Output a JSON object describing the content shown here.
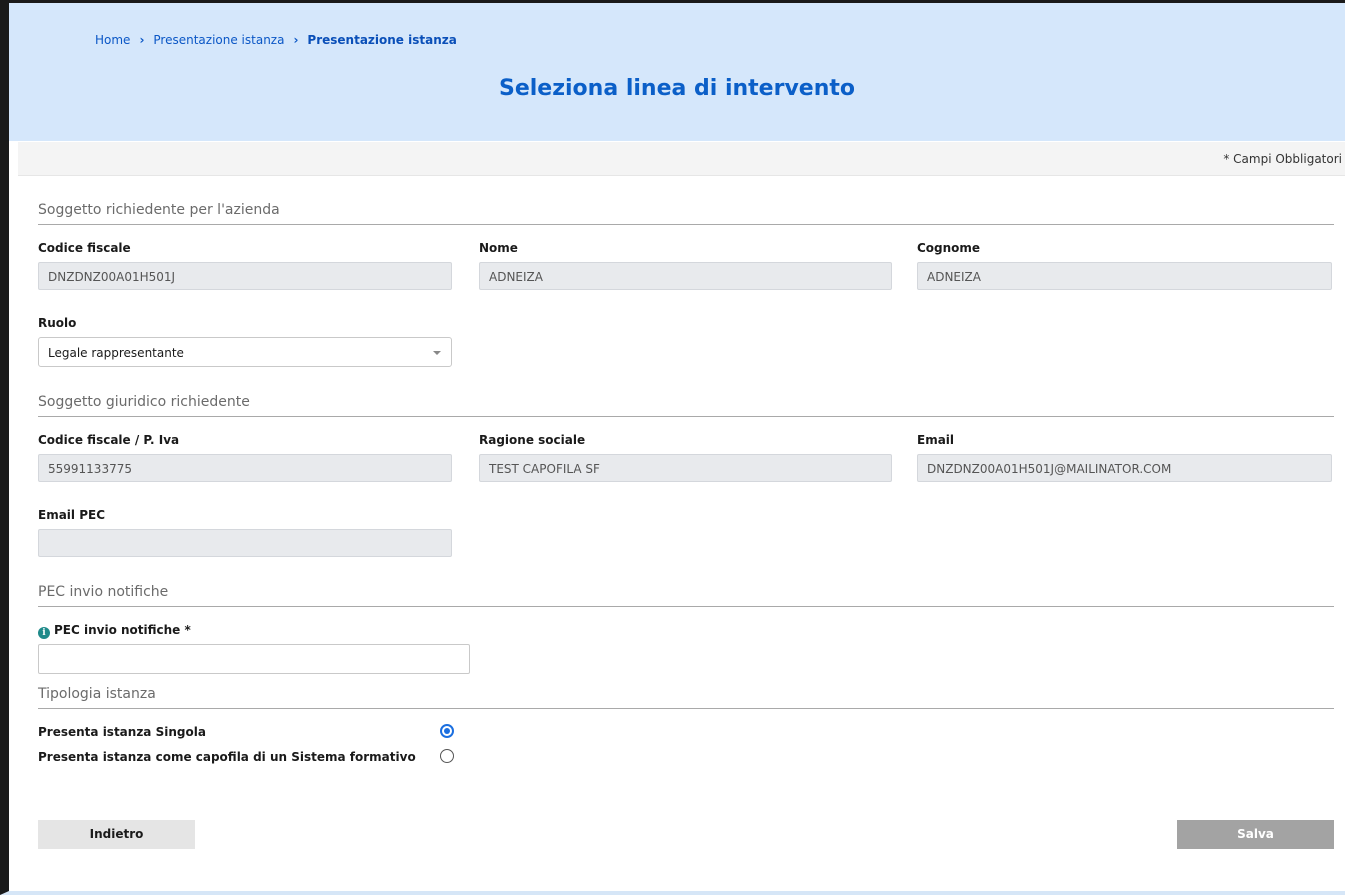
{
  "breadcrumb": {
    "home": "Home",
    "sep1": "›",
    "level2": "Presentazione istanza",
    "sep2": "›",
    "current": "Presentazione istanza"
  },
  "page_title": "Seleziona linea di intervento",
  "required_note": "* Campi Obbligatori",
  "sections": {
    "soggetto_richiedente": {
      "title": "Soggetto richiedente per l'azienda",
      "codice_fiscale_label": "Codice fiscale",
      "codice_fiscale_value": "DNZDNZ00A01H501J",
      "nome_label": "Nome",
      "nome_value": "ADNEIZA",
      "cognome_label": "Cognome",
      "cognome_value": "ADNEIZA",
      "ruolo_label": "Ruolo",
      "ruolo_value": "Legale rappresentante"
    },
    "soggetto_giuridico": {
      "title": "Soggetto giuridico richiedente",
      "cf_piva_label": "Codice fiscale / P. Iva",
      "cf_piva_value": "55991133775",
      "ragione_sociale_label": "Ragione sociale",
      "ragione_sociale_value": "TEST CAPOFILA SF",
      "email_label": "Email",
      "email_value": "DNZDNZ00A01H501J@MAILINATOR.COM",
      "email_pec_label": "Email PEC",
      "email_pec_value": ""
    },
    "pec_notifiche": {
      "title": "PEC invio notifiche",
      "field_label": "PEC invio notifiche *",
      "field_value": ""
    },
    "tipologia": {
      "title": "Tipologia istanza",
      "option_singola": "Presenta istanza Singola",
      "option_capofila": "Presenta istanza come capofila di un Sistema formativo",
      "selected": "singola"
    }
  },
  "buttons": {
    "back": "Indietro",
    "save": "Salva"
  },
  "icons": {
    "info": "info-icon",
    "caret": "chevron-down-icon"
  },
  "colors": {
    "header_bg": "#d5e7fb",
    "title": "#0b5fc8",
    "link": "#0b57c6",
    "radio": "#1b6fe0"
  }
}
